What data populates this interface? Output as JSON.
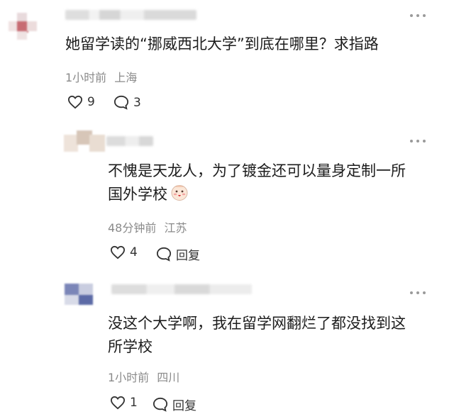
{
  "comments": [
    {
      "text": "她留学读的“挪威西北大学”到底在哪里？求指路",
      "time": "1小时前",
      "location": "上海",
      "likes": "9",
      "replies": "3"
    },
    {
      "text_line1": "不愧是天龙人，为了镀金还可以量身定制一所",
      "text_line2": "国外学校",
      "emoji": "emoji-face-icon",
      "time": "48分钟前",
      "location": "江苏",
      "likes": "4",
      "reply_label": "回复"
    },
    {
      "text_line1": "没这个大学啊，我在留学网翻烂了都没找到这",
      "text_line2": "所学校",
      "time": "1小时前",
      "location": "四川",
      "likes": "1",
      "reply_label": "回复"
    }
  ],
  "colors": {
    "text": "#1c1c1c",
    "meta": "#8a8a8a",
    "background": "#ffffff"
  }
}
